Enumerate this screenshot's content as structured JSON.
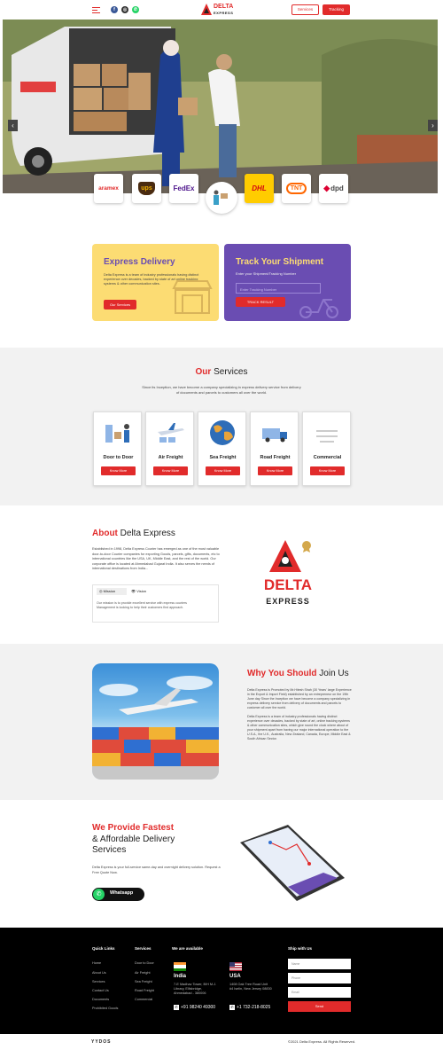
{
  "header": {
    "services_label": "Services",
    "tracking_label": "Tracking",
    "logo_name": "DELTA",
    "logo_sub": "EXPRESS"
  },
  "carriers": [
    "aramex",
    "ups",
    "FedEx",
    "",
    "DHL",
    "TNT",
    "dpd"
  ],
  "express": {
    "title": "Express Delivery",
    "desc": "Delta Express is a team of industry professionals having distinct experience over decades, backed by state of art online tracking systems & other communication sites.",
    "button": "Our Services"
  },
  "track": {
    "title": "Track Your Shipment",
    "subtitle": "Enter your Shipment/Tracking Number",
    "placeholder": "Enter Tracking Number",
    "button": "TRACK RESULT"
  },
  "services": {
    "title_accent": "Our",
    "title_rest": "Services",
    "desc": "Since its Inception, we have become a company specializing in express delivery service from delivery of documents and parcels to customers all over the world.",
    "items": [
      {
        "name": "Door to Door",
        "button": "Know More"
      },
      {
        "name": "Air Freight",
        "button": "Know More"
      },
      {
        "name": "Sea Freight",
        "button": "Know More"
      },
      {
        "name": "Road Freight",
        "button": "Know More"
      },
      {
        "name": "Commercial",
        "button": "Know More"
      }
    ]
  },
  "about": {
    "title_accent": "About",
    "title_rest": "Delta Express",
    "desc": "Established in 1998, Delta Express Courier has emerged as one of the most valuable door-to-door Courier companies for exporting Goods, parcels, gifts, documents, etc to international countries like the USA, UK, Middle East, and the rest of the world. Our corporate office is located at Ahmedabad Gujarat India. It also serves the needs of international destinations from India...",
    "tab_mission": "Mission",
    "tab_vision": "Vision",
    "mission_text": "Our mission is to provide excellent service with express couriers Management is looking to help their customers find approach.",
    "logo_name": "DELTA",
    "logo_sub": "EXPRESS"
  },
  "why": {
    "title_accent": "Why You Should",
    "title_rest": "Join Us",
    "p1": "Delta Express is Promoted by Mr.Hitesh Shah (30 Years' large Experience in the Export & Import Field) established by an entrepreneur on the 19th June day Since the Inception we have become a company specializing in express delivery service from delivery of documents and parcels to customer all over the world.",
    "p2": "Delta Express is a team of industry professionals having distinct experience over decades, backed by state of art, online tracking systems & other communication sites, which give round the clock where about of your shipment apart from having our major international operation to the U.S.A., the U.K., Australia, New Zealand, Canada, Europe, Middle East & South African Sector."
  },
  "fastest": {
    "title_accent": "We Provide Fastest",
    "title_l2": "& Affordable Delivery",
    "title_l3": "Services",
    "desc": "Delta Express is your full-service same-day and overnight delivery solution. Request a Free Quote Now.",
    "whatsapp": "Whatsapp"
  },
  "footer": {
    "quick_title": "Quick Links",
    "quick": [
      "Home",
      "About Us",
      "Services",
      "Contact Us",
      "Documents",
      "Prohibited Goods"
    ],
    "svc_title": "Services",
    "svc": [
      "Door to Door",
      "Air Freight",
      "Sea Freight",
      "Road Freight",
      "Commercial"
    ],
    "avail_title": "We are available",
    "india": {
      "name": "India",
      "addr": "7-E Madhav Tower, B/H M.J. Library, Ellisbridge, Ahmedabad - 380006",
      "phone": "+91 98240 49300"
    },
    "usa": {
      "name": "USA",
      "addr": "1408 Oak Tree Road Unit #4 Iselin, New Jersey 08830",
      "phone": "+1 732-218-8025"
    },
    "ship_title": "Ship with Us",
    "name_ph": "Name",
    "phone_ph": "Phone",
    "email_ph": "Email",
    "send": "Send",
    "copyright": "©2021 Delta Express. All Rights Reserved.",
    "brand": "YYDOS"
  },
  "colors": {
    "accent": "#e12b2b",
    "yellow": "#fcdc73",
    "purple": "#6a4db2"
  }
}
